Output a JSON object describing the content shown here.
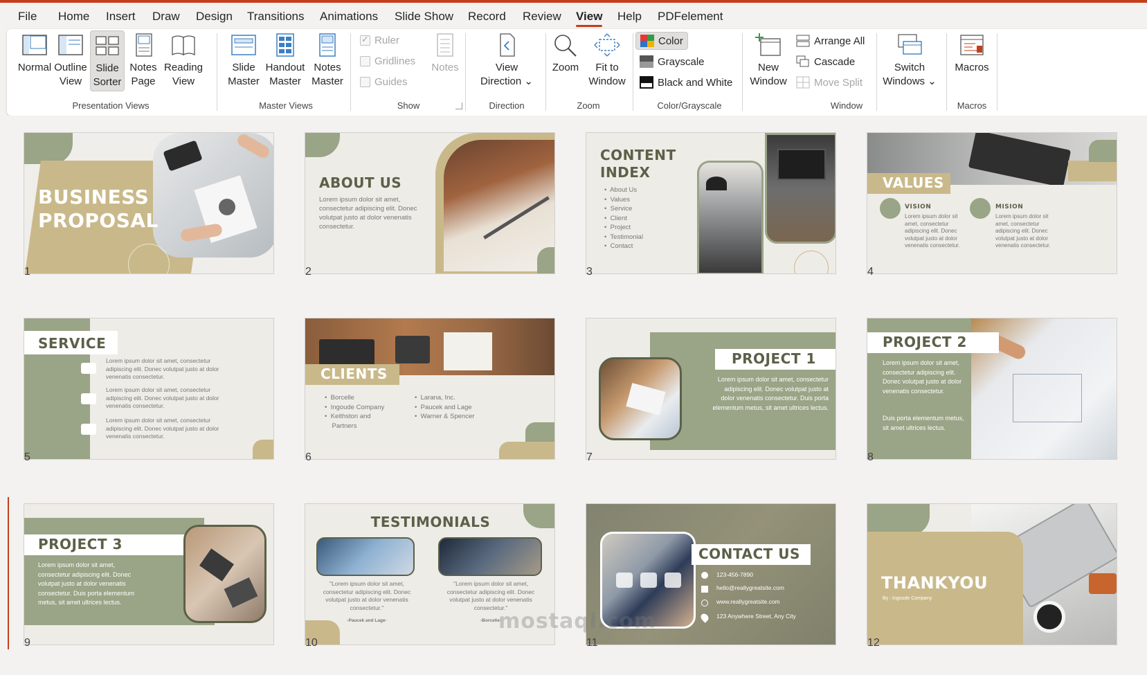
{
  "menu": {
    "items": [
      "File",
      "Home",
      "Insert",
      "Draw",
      "Design",
      "Transitions",
      "Animations",
      "Slide Show",
      "Record",
      "Review",
      "View",
      "Help",
      "PDFelement"
    ],
    "active": "View"
  },
  "ribbon": {
    "presentation_views": {
      "label": "Presentation Views",
      "buttons": [
        {
          "line1": "Normal",
          "line2": ""
        },
        {
          "line1": "Outline",
          "line2": "View"
        },
        {
          "line1": "Slide",
          "line2": "Sorter"
        },
        {
          "line1": "Notes",
          "line2": "Page"
        },
        {
          "line1": "Reading",
          "line2": "View"
        }
      ]
    },
    "master_views": {
      "label": "Master Views",
      "buttons": [
        {
          "line1": "Slide",
          "line2": "Master"
        },
        {
          "line1": "Handout",
          "line2": "Master"
        },
        {
          "line1": "Notes",
          "line2": "Master"
        }
      ]
    },
    "show": {
      "label": "Show",
      "ruler": "Ruler",
      "gridlines": "Gridlines",
      "guides": "Guides",
      "notes": "Notes"
    },
    "direction": {
      "label": "Direction",
      "line1": "View",
      "line2": "Direction"
    },
    "zoom": {
      "label": "Zoom",
      "zoom": "Zoom",
      "fit1": "Fit to",
      "fit2": "Window"
    },
    "color": {
      "label": "Color/Grayscale",
      "color": "Color",
      "grayscale": "Grayscale",
      "bw": "Black and White"
    },
    "window": {
      "label": "Window",
      "new1": "New",
      "new2": "Window",
      "arrange": "Arrange All",
      "cascade": "Cascade",
      "move_split": "Move Split",
      "switch1": "Switch",
      "switch2": "Windows"
    },
    "macros": {
      "label": "Macros",
      "macros": "Macros"
    }
  },
  "slides": {
    "s1": {
      "num": "1",
      "title1": "BUSINESS",
      "title2": "PROPOSAL"
    },
    "s2": {
      "num": "2",
      "title": "ABOUT US",
      "body": "Lorem ipsum dolor sit amet, consectetur adipiscing elit. Donec volutpat justo at dolor venenatis consectetur."
    },
    "s3": {
      "num": "3",
      "title1": "CONTENT",
      "title2": "INDEX",
      "items": "•  About Us\n•  Values\n•  Service\n•  Client\n•  Project\n•  Testimonial\n•  Contact"
    },
    "s4": {
      "num": "4",
      "title": "VALUES",
      "vision": "VISION",
      "mision": "MISION",
      "body": "Lorem ipsum dolor sit amet, consectetur adipiscing elit. Donec volutpat justo at dolor venenatis consectetur."
    },
    "s5": {
      "num": "5",
      "title": "SERVICE",
      "body": "Lorem ipsum dolor sit amet, consectetur adipiscing elit. Donec volutpat justo at dolor venenatis consectetur."
    },
    "s6": {
      "num": "6",
      "title": "CLIENTS",
      "col1": "•  Borcelle\n•  Ingoude Company\n•  Keithston and\n    Partners",
      "col2": "•  Larana, Inc.\n•  Paucek and Lage\n•  Warner & Spencer"
    },
    "s7": {
      "num": "7",
      "title": "PROJECT 1",
      "body": "Lorem ipsum dolor sit amet, consectetur adipiscing elit. Donec volutpat justo at dolor venenatis consectetur. Duis porta elementum metus, sit amet ultrices lectus."
    },
    "s8": {
      "num": "8",
      "title": "PROJECT 2",
      "body1": "Lorem ipsum dolor sit amet, consectetur adipiscing elit. Donec volutpat justo at dolor venenatis consectetur.",
      "body2": "Duis porta elementum metus, sit amet ultrices lectus."
    },
    "s9": {
      "num": "9",
      "title": "PROJECT 3",
      "body": "Lorem ipsum dolor sit amet, consectetur adipiscing elit. Donec volutpat justo at dolor venenatis consectetur. Duis porta elementum metus, sit amet ultrices lectus."
    },
    "s10": {
      "num": "10",
      "title": "TESTIMONIALS",
      "quote": "\"Lorem ipsum dolor sit amet, consectetur adipiscing elit. Donec volutpat justo at dolor venenatis consectetur.\"",
      "author1": "-Paucek and Lage-",
      "author2": "-Borcelle-"
    },
    "s11": {
      "num": "11",
      "title": "CONTACT US",
      "phone": "123-456-7890",
      "email": "hello@reallygreatsite.com",
      "web": "www.reallygreatsite.com",
      "addr": "123 Anywhere Street, Any City"
    },
    "s12": {
      "num": "12",
      "title": "THANKYOU",
      "by": "By : Ingoude Company"
    }
  },
  "watermark": "mostaql.com",
  "colors": {
    "accent": "#c43e1c",
    "olive": "#9aa486",
    "sand": "#c9b98a",
    "paper": "#eeece7"
  }
}
